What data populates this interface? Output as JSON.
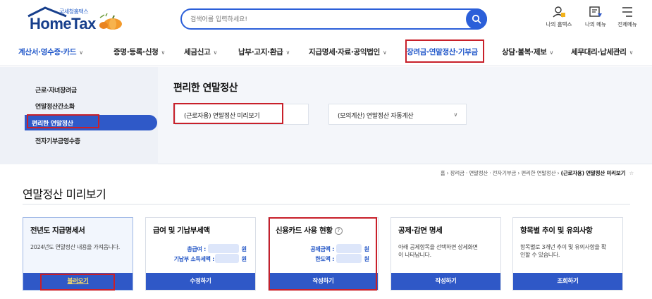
{
  "header": {
    "logo_sub": "국세청홈택스",
    "logo_main": "HomeTax",
    "search_placeholder": "검색어를 입력하세요!",
    "utils": [
      {
        "label": "나의 홈택스",
        "icon": "user-home-icon"
      },
      {
        "label": "나의 메뉴",
        "icon": "my-menu-icon"
      },
      {
        "label": "전체메뉴",
        "icon": "hamburger-menu-icon"
      }
    ]
  },
  "gnb": [
    {
      "label": "계산서·영수증·카드"
    },
    {
      "label": "증명·등록·신청"
    },
    {
      "label": "세금신고"
    },
    {
      "label": "납부·고지·환급"
    },
    {
      "label": "지급명세·자료·공익법인"
    },
    {
      "label": "장려금·연말정산·기부금"
    },
    {
      "label": "상담·불복·제보"
    },
    {
      "label": "세무대리·납세관리"
    }
  ],
  "sidebar": {
    "items": [
      {
        "label": "근로·자녀장려금"
      },
      {
        "label": "연말정산간소화"
      },
      {
        "label": "편리한 연말정산"
      },
      {
        "label": "전자기부금영수증"
      }
    ]
  },
  "panel": {
    "title": "편리한 연말정산",
    "options": [
      {
        "label": "(근로자용) 연말정산 미리보기"
      },
      {
        "label": "(모의계산) 연말정산 자동계산"
      }
    ]
  },
  "breadcrumb": {
    "trail": "홈 › 장려금 · 연말정산 · 전자기부금 › 편리한 연말정산 › ",
    "current": "(근로자용) 연말정산 미리보기",
    "star": "☆"
  },
  "page": {
    "title": "연말정산 미리보기"
  },
  "cards": [
    {
      "title": "전년도 지급명세서",
      "desc": "2024년도 연말정산 내용을 가져옵니다.",
      "button": "불러오기"
    },
    {
      "title": "급여 및 기납부세액",
      "line1_label": "총급여 :",
      "line1_unit": "원",
      "line2_label": "기납부 소득세액 :",
      "line2_unit": "원",
      "button": "수정하기"
    },
    {
      "title": "신용카드 사용 현황",
      "help": "?",
      "line1_label": "공제금액 :",
      "line1_unit": "원",
      "line2_label": "한도액 :",
      "line2_unit": "원",
      "button": "작성하기"
    },
    {
      "title": "공제·감면 명세",
      "desc": "아래 공제항목을 선택하면 상세화면이 나타납니다.",
      "button": "작성하기"
    },
    {
      "title": "항목별 추이 및 유의사항",
      "desc": "항목별로 3개년 추이 및 유의사항을 확인할 수 있습니다.",
      "button": "조회하기"
    }
  ],
  "colors": {
    "brand": "#2f58c7",
    "highlight": "#c8202a"
  }
}
